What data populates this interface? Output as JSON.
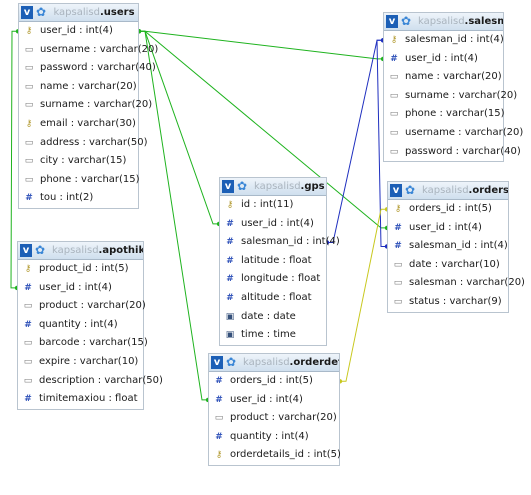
{
  "db_name": "kapsalisd",
  "tables": {
    "users": {
      "name": "users",
      "columns": [
        {
          "icon": "key",
          "text": "user_id : int(4)"
        },
        {
          "icon": "text",
          "text": "username : varchar(20)"
        },
        {
          "icon": "text",
          "text": "password : varchar(40)"
        },
        {
          "icon": "text",
          "text": "name : varchar(20)"
        },
        {
          "icon": "text",
          "text": "surname : varchar(20)"
        },
        {
          "icon": "key",
          "text": "email : varchar(30)"
        },
        {
          "icon": "text",
          "text": "address : varchar(50)"
        },
        {
          "icon": "text",
          "text": "city : varchar(15)"
        },
        {
          "icon": "text",
          "text": "phone : varchar(15)"
        },
        {
          "icon": "num",
          "text": "tou : int(2)"
        }
      ]
    },
    "salesman": {
      "name": "salesman",
      "columns": [
        {
          "icon": "key",
          "text": "salesman_id : int(4)"
        },
        {
          "icon": "num",
          "text": "user_id : int(4)"
        },
        {
          "icon": "text",
          "text": "name : varchar(20)"
        },
        {
          "icon": "text",
          "text": "surname : varchar(20)"
        },
        {
          "icon": "text",
          "text": "phone : varchar(15)"
        },
        {
          "icon": "text",
          "text": "username : varchar(20)"
        },
        {
          "icon": "text",
          "text": "password : varchar(40)"
        }
      ]
    },
    "gps": {
      "name": "gps",
      "columns": [
        {
          "icon": "key",
          "text": "id : int(11)"
        },
        {
          "icon": "num",
          "text": "user_id : int(4)"
        },
        {
          "icon": "num",
          "text": "salesman_id : int(4)"
        },
        {
          "icon": "num",
          "text": "latitude : float"
        },
        {
          "icon": "num",
          "text": "longitude : float"
        },
        {
          "icon": "num",
          "text": "altitude : float"
        },
        {
          "icon": "date",
          "text": "date : date"
        },
        {
          "icon": "date",
          "text": "time : time"
        }
      ]
    },
    "orders": {
      "name": "orders",
      "columns": [
        {
          "icon": "key",
          "text": "orders_id : int(5)"
        },
        {
          "icon": "num",
          "text": "user_id : int(4)"
        },
        {
          "icon": "num",
          "text": "salesman_id : int(4)"
        },
        {
          "icon": "text",
          "text": "date : varchar(10)"
        },
        {
          "icon": "text",
          "text": "salesman : varchar(20)"
        },
        {
          "icon": "text",
          "text": "status : varchar(9)"
        }
      ]
    },
    "apothiki": {
      "name": "apothiki",
      "columns": [
        {
          "icon": "key",
          "text": "product_id : int(5)"
        },
        {
          "icon": "num",
          "text": "user_id : int(4)"
        },
        {
          "icon": "text",
          "text": "product : varchar(20)"
        },
        {
          "icon": "num",
          "text": "quantity : int(4)"
        },
        {
          "icon": "text",
          "text": "barcode : varchar(15)"
        },
        {
          "icon": "text",
          "text": "expire : varchar(10)"
        },
        {
          "icon": "text",
          "text": "description : varchar(50)"
        },
        {
          "icon": "num",
          "text": "timitemaxiou : float"
        }
      ]
    },
    "orderdetails": {
      "name": "orderdetails",
      "columns": [
        {
          "icon": "num",
          "text": "orders_id : int(5)"
        },
        {
          "icon": "num",
          "text": "user_id : int(4)"
        },
        {
          "icon": "text",
          "text": "product : varchar(20)"
        },
        {
          "icon": "num",
          "text": "quantity : int(4)"
        },
        {
          "icon": "key",
          "text": "orderdetails_id : int(5)"
        }
      ]
    }
  },
  "relations": [
    {
      "from": "users.user_id",
      "to": "salesman.user_id",
      "color": "#1fb31f"
    },
    {
      "from": "users.user_id",
      "to": "gps.user_id",
      "color": "#1fb31f"
    },
    {
      "from": "users.user_id",
      "to": "orders.user_id",
      "color": "#1fb31f"
    },
    {
      "from": "users.user_id",
      "to": "apothiki.user_id",
      "color": "#1fb31f"
    },
    {
      "from": "users.user_id",
      "to": "orderdetails.user_id",
      "color": "#1fb31f"
    },
    {
      "from": "salesman.salesman_id",
      "to": "gps.salesman_id",
      "color": "#1f2fbf"
    },
    {
      "from": "salesman.salesman_id",
      "to": "orders.salesman_id",
      "color": "#1f2fbf"
    },
    {
      "from": "orders.orders_id",
      "to": "orderdetails.orders_id",
      "color": "#c8c81e"
    }
  ]
}
